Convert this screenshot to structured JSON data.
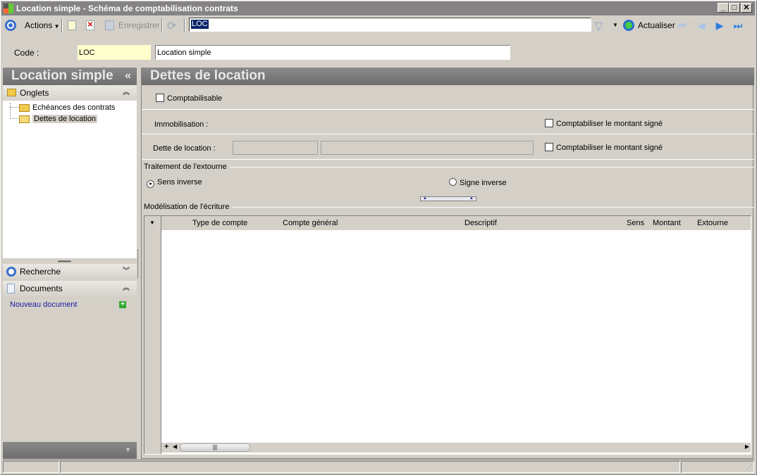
{
  "window": {
    "title": "Location simple  -  Schéma de comptabilisation contrats",
    "minimize": "_",
    "maximize": "□",
    "close": "✕"
  },
  "toolbar": {
    "actions_label": "Actions",
    "save_label": "Enregistrer",
    "search_value": "LOC",
    "refresh_label": "Actualiser"
  },
  "header": {
    "code_label": "Code :",
    "code_value": "LOC",
    "name_value": "Location simple"
  },
  "sidebar": {
    "title": "Location simple",
    "collapse": "«",
    "onglets_label": "Onglets",
    "tree": [
      {
        "label": "Echéances des contrats"
      },
      {
        "label": "Dettes de location"
      }
    ],
    "recherche_label": "Recherche",
    "documents_label": "Documents",
    "new_document_label": "Nouveau document"
  },
  "main": {
    "title": "Dettes de location",
    "comptabilisable_label": "Comptabilisable",
    "immobilisation_label": "Immobilisation :",
    "dette_label": "Dette de location :",
    "signed_amount_label": "Comptabiliser le montant signé",
    "extourne_group": "Traitement de l'extourne",
    "radio_sens": "Sens inverse",
    "radio_signe": "Signe inverse",
    "modelisation_group": "Modélisation de l'écriture",
    "grid": {
      "columns": [
        "Type de compte",
        "Compte général",
        "Descriptif",
        "Sens",
        "Montant",
        "Extourne"
      ],
      "rows": []
    }
  }
}
